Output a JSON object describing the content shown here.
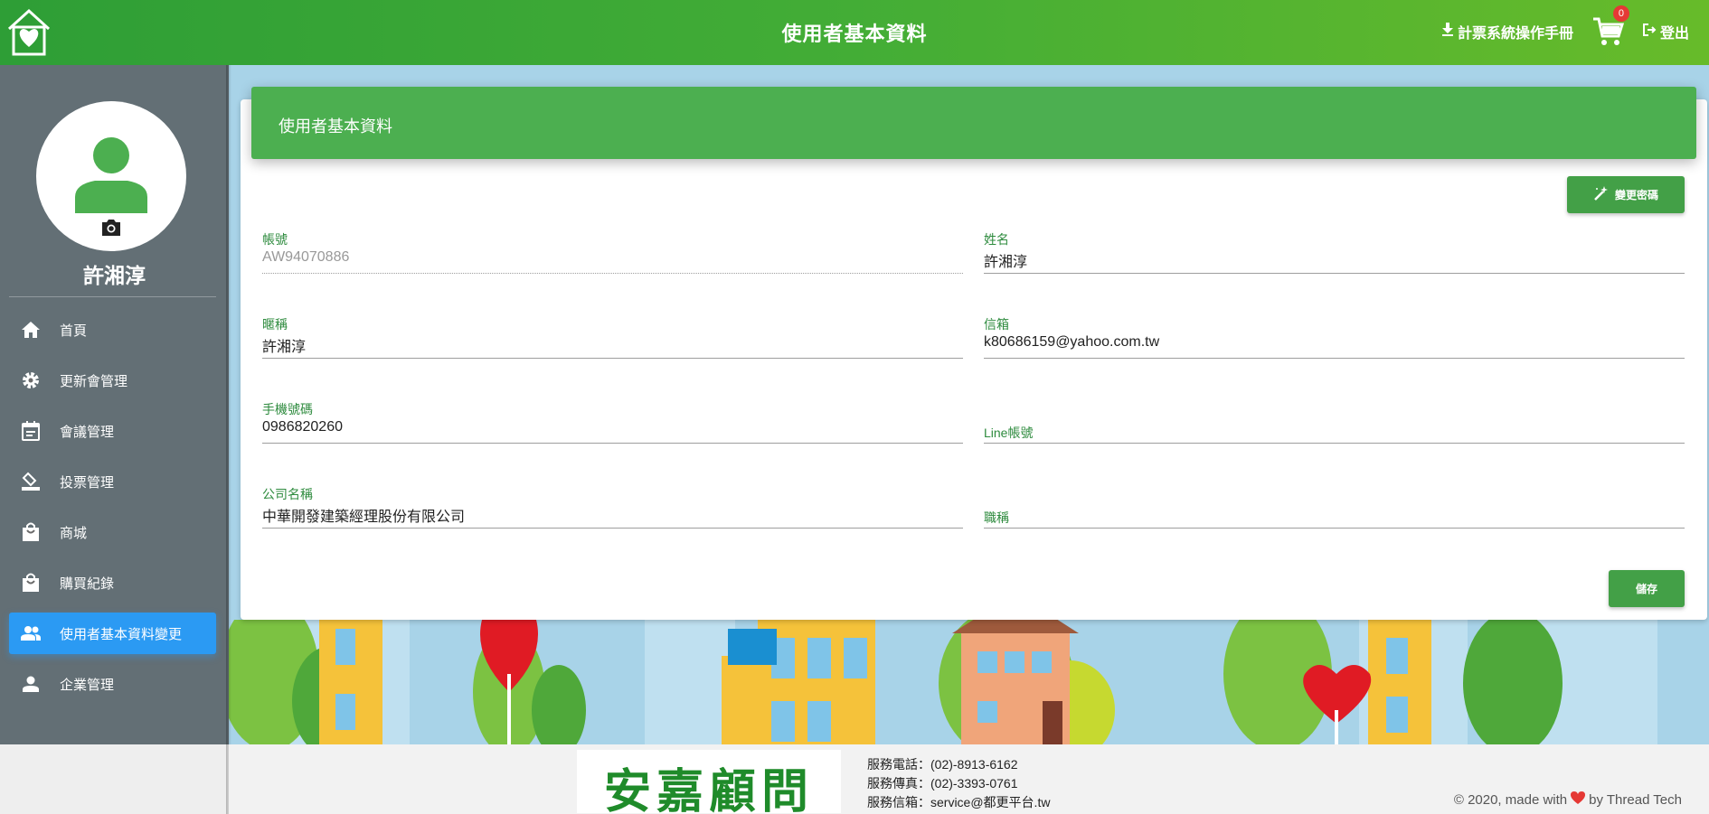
{
  "header": {
    "title": "使用者基本資料",
    "manual_label": "計票系統操作手冊",
    "cart_count": "0",
    "logout_label": "登出"
  },
  "sidebar": {
    "user_name": "許湘淳",
    "items": [
      {
        "label": "首頁",
        "icon": "home-icon"
      },
      {
        "label": "更新會管理",
        "icon": "gear-icon"
      },
      {
        "label": "會議管理",
        "icon": "calendar-icon"
      },
      {
        "label": "投票管理",
        "icon": "ballot-icon"
      },
      {
        "label": "商城",
        "icon": "shopping-bag-icon"
      },
      {
        "label": "購買紀錄",
        "icon": "shopping-bag-icon"
      },
      {
        "label": "使用者基本資料變更",
        "icon": "people-icon",
        "active": true
      },
      {
        "label": "企業管理",
        "icon": "person-icon"
      }
    ]
  },
  "card": {
    "title": "使用者基本資料",
    "change_password_label": "變更密碼",
    "save_label": "儲存",
    "fields": {
      "account": {
        "label": "帳號",
        "value": "AW94070886"
      },
      "name": {
        "label": "姓名",
        "value": "許湘淳"
      },
      "nickname": {
        "label": "暱稱",
        "value": "許湘淳"
      },
      "email": {
        "label": "信箱",
        "value": "k80686159@yahoo.com.tw"
      },
      "mobile": {
        "label": "手機號碼",
        "value": "0986820260"
      },
      "line": {
        "label": "Line帳號",
        "value": ""
      },
      "company": {
        "label": "公司名稱",
        "value": "中華開發建築經理股份有限公司"
      },
      "job_title": {
        "label": "職稱",
        "value": ""
      }
    }
  },
  "footer": {
    "logo_text": "安嘉顧問",
    "phone": "服務電話：(02)-8913-6162",
    "fax": "服務傳真：(02)-3393-0761",
    "email": "服務信箱：service@都更平台.tw",
    "copyright_prefix": "© 2020, made with",
    "copyright_suffix": "by Thread Tech"
  },
  "colors": {
    "header_green": "#43ad36",
    "card_header_green": "#4caf50",
    "active_nav_blue": "#2b9af3",
    "label_green": "#2e8b3e"
  }
}
